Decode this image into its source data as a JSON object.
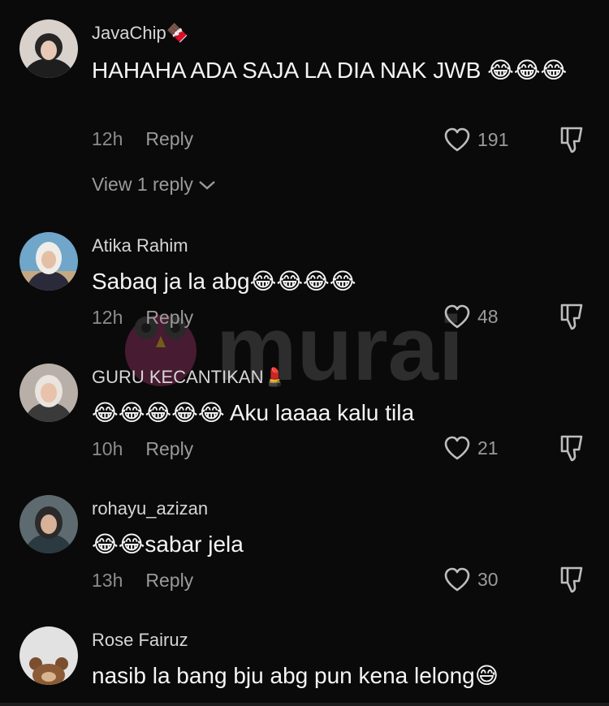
{
  "comments": [
    {
      "username": "JavaChip",
      "username_emoji": "🍫",
      "text": "HAHAHA ADA SAJA LA DIA NAK JWB 😂😂😂",
      "time": "12h",
      "reply_label": "Reply",
      "likes": "191",
      "view_replies": "View 1 reply"
    },
    {
      "username": "Atika Rahim",
      "text": "Sabaq ja la abg😂😂😂😂",
      "time": "12h",
      "reply_label": "Reply",
      "likes": "48"
    },
    {
      "username": "GURU KECANTIKAN",
      "username_emoji": "💄",
      "text": "😂😂😂😂😂 Aku laaaa kalu tila",
      "time": "10h",
      "reply_label": "Reply",
      "likes": "21"
    },
    {
      "username": "rohayu_azizan",
      "text": "😂😂sabar jela",
      "time": "13h",
      "reply_label": "Reply",
      "likes": "30"
    },
    {
      "username": "Rose Fairuz",
      "text": "nasib la bang bju abg pun kena lelong😅"
    }
  ],
  "watermark": {
    "text": "murai"
  },
  "icons": {
    "like": "heart-outline-icon",
    "dislike": "thumbs-down-icon",
    "chevron": "chevron-down-icon"
  },
  "colors": {
    "background": "#0a0a0a",
    "text": "#f5f5f5",
    "muted": "#9a9a9a"
  }
}
